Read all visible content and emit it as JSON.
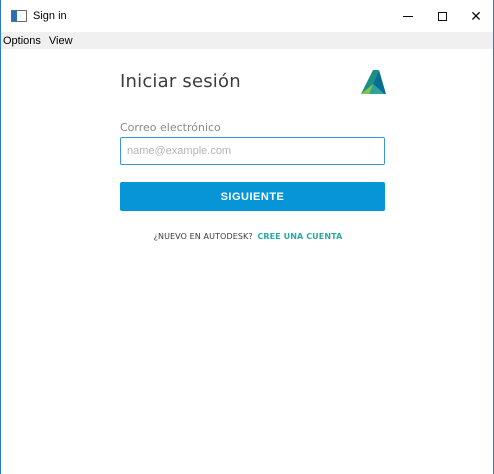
{
  "window": {
    "title": "Sign in",
    "controls": {
      "minimize": "–",
      "maximize": "☐",
      "close": "✕"
    },
    "border_color": "#2b79d0"
  },
  "menubar": {
    "items": [
      "Options",
      "View"
    ]
  },
  "signin": {
    "heading": "Iniciar sesión",
    "email_label": "Correo electrónico",
    "email_placeholder": "name@example.com",
    "email_value": "",
    "next_button": "SIGUIENTE",
    "signup_prompt": "¿NUEVO EN AUTODESK?",
    "signup_link": "CREE UNA CUENTA",
    "logo_icon": "autodesk-logo"
  },
  "colors": {
    "accent": "#0696d7",
    "link": "#2aa8a2",
    "input_border": "#3a96d6"
  }
}
